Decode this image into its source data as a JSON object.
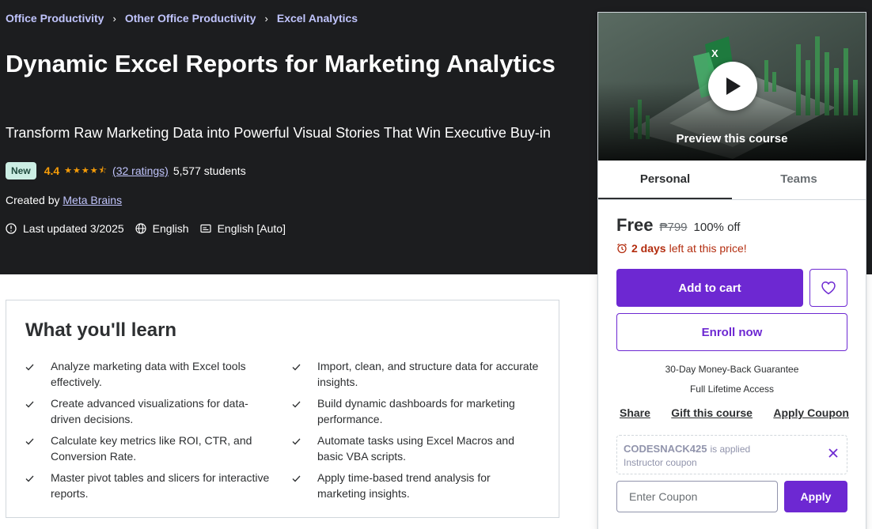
{
  "breadcrumb": [
    "Office Productivity",
    "Other Office Productivity",
    "Excel Analytics"
  ],
  "course": {
    "title": "Dynamic Excel Reports for Marketing Analytics",
    "subtitle": "Transform Raw Marketing Data into Powerful Visual Stories That Win Executive Buy-in",
    "badge": "New",
    "rating": "4.4",
    "rating_stars": 4.4,
    "ratings_count": "(32 ratings)",
    "students": "5,577 students",
    "created_by_label": "Created by",
    "author": "Meta Brains",
    "last_updated": "Last updated 3/2025",
    "language": "English",
    "captions": "English [Auto]"
  },
  "learn": {
    "title": "What you'll learn",
    "items": [
      "Analyze marketing data with Excel tools effectively.",
      "Import, clean, and structure data for accurate insights.",
      "Create advanced visualizations for data-driven decisions.",
      "Build dynamic dashboards for marketing performance.",
      "Calculate key metrics like ROI, CTR, and Conversion Rate.",
      "Automate tasks using Excel Macros and basic VBA scripts.",
      "Master pivot tables and slicers for interactive reports.",
      "Apply time-based trend analysis for marketing insights."
    ]
  },
  "sidebar": {
    "preview_label": "Preview this course",
    "tabs": [
      "Personal",
      "Teams"
    ],
    "price": "Free",
    "original_price": "₱799",
    "discount": "100% off",
    "deadline_bold": "2 days",
    "deadline_rest": "left at this price!",
    "add_to_cart": "Add to cart",
    "enroll": "Enroll now",
    "guarantee": "30-Day Money-Back Guarantee",
    "lifetime": "Full Lifetime Access",
    "links": [
      "Share",
      "Gift this course",
      "Apply Coupon"
    ],
    "coupon_code": "CODESNACK425",
    "coupon_applied": "is applied",
    "coupon_type": "Instructor coupon",
    "coupon_placeholder": "Enter Coupon",
    "apply_label": "Apply"
  },
  "colors": {
    "hero_bg": "#1c1d1f",
    "accent": "#6d28d2",
    "link_light": "#c0c4fc",
    "star": "#f69c08",
    "badge_bg": "#cceee4",
    "deadline": "#b32d0f"
  }
}
